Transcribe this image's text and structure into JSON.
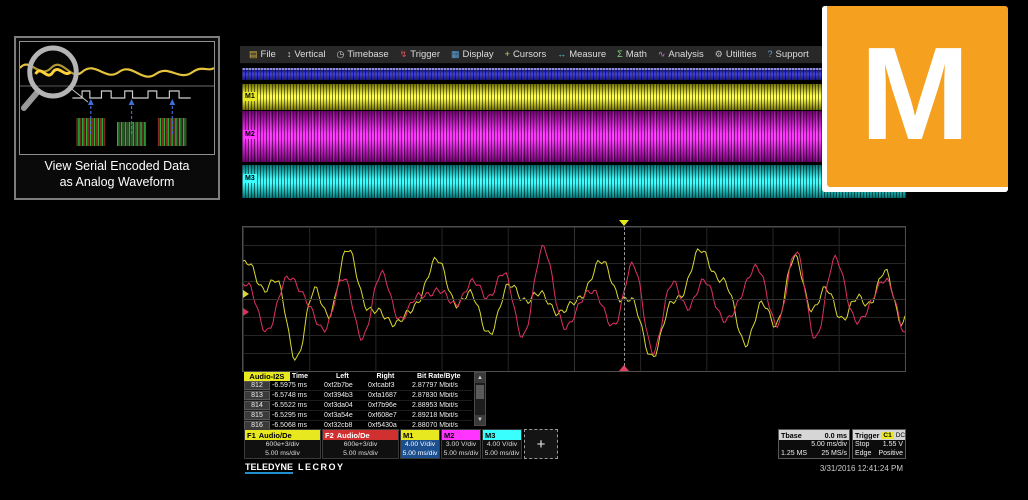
{
  "promo": {
    "caption_line1": "View Serial Encoded Data",
    "caption_line2": "as Analog Waveform"
  },
  "m_logo": {
    "letter": "M",
    "color": "#F5A01E"
  },
  "scope": {
    "menu": [
      {
        "label": "File",
        "icon": "file",
        "glyph": "▤",
        "icon_color": "#d9b84a"
      },
      {
        "label": "Vertical",
        "icon": "vertical-arrows",
        "glyph": "↕",
        "icon_color": "#cfcfcf"
      },
      {
        "label": "Timebase",
        "icon": "clock",
        "glyph": "◷",
        "icon_color": "#cfcfcf"
      },
      {
        "label": "Trigger",
        "icon": "trigger-bolt",
        "glyph": "↯",
        "icon_color": "#d85050"
      },
      {
        "label": "Display",
        "icon": "display-grid",
        "glyph": "▦",
        "icon_color": "#5aa0d8"
      },
      {
        "label": "Cursors",
        "icon": "cursors-cross",
        "glyph": "+",
        "icon_color": "#d8d850"
      },
      {
        "label": "Measure",
        "icon": "measure-arrows",
        "glyph": "↔",
        "icon_color": "#50c8c8"
      },
      {
        "label": "Math",
        "icon": "math-sigma",
        "glyph": "Σ",
        "icon_color": "#7ad87a"
      },
      {
        "label": "Analysis",
        "icon": "analysis-wave",
        "glyph": "∿",
        "icon_color": "#c080d8"
      },
      {
        "label": "Utilities",
        "icon": "utilities-gear",
        "glyph": "⚙",
        "icon_color": "#c0c0c0"
      },
      {
        "label": "Support",
        "icon": "support-question",
        "glyph": "?",
        "icon_color": "#5aa0d8"
      }
    ],
    "channels": [
      {
        "id": "M1",
        "color": "#e8e820"
      },
      {
        "id": "M2",
        "color": "#ff35ff"
      },
      {
        "id": "M3",
        "color": "#39ffff"
      }
    ],
    "decode_table": {
      "tab": "Audio-I2S",
      "headers": [
        "Time",
        "Left",
        "Right",
        "Bit Rate/Byte"
      ],
      "rows": [
        [
          "812",
          "-6.5975 ms",
          "0xf2b7be",
          "0xfcabf3",
          "2.87797 Mbit/s"
        ],
        [
          "813",
          "-6.5748 ms",
          "0xf394b3",
          "0xfa1687",
          "2.87830 Mbit/s"
        ],
        [
          "814",
          "-6.5522 ms",
          "0xf3da04",
          "0xf7b96e",
          "2.88953 Mbit/s"
        ],
        [
          "815",
          "-6.5295 ms",
          "0xf3a54e",
          "0xf608e7",
          "2.89218 Mbit/s"
        ],
        [
          "816",
          "-6.5068 ms",
          "0xf32cb8",
          "0xf5430a",
          "2.88070 Mbit/s"
        ]
      ]
    },
    "descriptors": [
      {
        "id": "F1",
        "name": "Audio/De",
        "line1": "600e+3/div",
        "line2": "5.00 ms/div",
        "color": "#e8e820",
        "head_text": "#000",
        "selected": false
      },
      {
        "id": "F2",
        "name": "Audio/De",
        "line1": "600e+3/div",
        "line2": "5.00 ms/div",
        "color": "#d03030",
        "head_text": "#fff",
        "selected": false
      },
      {
        "id": "M1",
        "name": "",
        "line1": "4.00 V/div",
        "line2": "5.00 ms/div",
        "color": "#e8e820",
        "head_text": "#000",
        "selected": true
      },
      {
        "id": "M2",
        "name": "",
        "line1": "3.00 V/div",
        "line2": "5.00 ms/div",
        "color": "#ff35ff",
        "head_text": "#000",
        "selected": false
      },
      {
        "id": "M3",
        "name": "",
        "line1": "4.00 V/div",
        "line2": "5.00 ms/div",
        "color": "#39ffff",
        "head_text": "#000",
        "selected": false
      }
    ],
    "add_button": "+",
    "tbase": {
      "label": "Tbase",
      "delay": "0.0 ms",
      "scale": "5.00 ms/div",
      "samples": "1.25 MS",
      "rate": "25 MS/s"
    },
    "trigger": {
      "label": "Trigger",
      "source": "C1",
      "coupling": "DC",
      "mode": "Stop",
      "level": "1.55 V",
      "type": "Edge",
      "slope": "Positive"
    },
    "brand": {
      "part1": "TELEDYNE",
      "part2": "LECROY"
    },
    "timestamp": "3/31/2016 12:41:24 PM",
    "traces": [
      {
        "name": "F1",
        "color": "#d8d830"
      },
      {
        "name": "F2",
        "color": "#e03060"
      }
    ]
  }
}
